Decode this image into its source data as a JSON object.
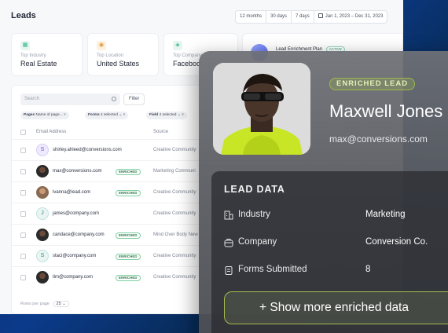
{
  "leads_page": {
    "title": "Leads",
    "range_tabs": [
      "12 months",
      "30 days",
      "7 days"
    ],
    "date_range": "Jan 1, 2023 – Dec 31, 2023",
    "stats": [
      {
        "label": "Top Industry",
        "value": "Real Estate",
        "icon": "building-icon",
        "color": "#2fb38a"
      },
      {
        "label": "Top Location",
        "value": "United States",
        "icon": "location-icon",
        "color": "#e1962b"
      },
      {
        "label": "Top Company",
        "value": "Faceboo",
        "icon": "company-icon",
        "color": "#2fb38a"
      }
    ],
    "plan": {
      "title": "Lead Enrichment Plan",
      "badge": "ACTIVE"
    },
    "table": {
      "search_placeholder": "Search",
      "filter_label": "Filter",
      "chips": [
        {
          "key": "Pages",
          "value": "Name of page..."
        },
        {
          "key": "Forms",
          "value": "4 selected"
        },
        {
          "key": "Field",
          "value": "4 selected"
        }
      ],
      "columns": [
        "Email Address",
        "Source"
      ],
      "rows": [
        {
          "avatar": "S",
          "avatar_type": "letter-purple",
          "email": "shirley.ahleed@conversions.com",
          "enriched": false,
          "source": "Creative Community"
        },
        {
          "avatar": "",
          "avatar_type": "photo",
          "email": "max@conversions.com",
          "enriched": true,
          "source": "Marketing Communi"
        },
        {
          "avatar": "",
          "avatar_type": "photo",
          "email": "lvanna@lead.com",
          "enriched": true,
          "source": "Creative Community"
        },
        {
          "avatar": "J",
          "avatar_type": "letter",
          "email": "james@company.com",
          "enriched": false,
          "source": "Creative Community"
        },
        {
          "avatar": "",
          "avatar_type": "photo",
          "email": "candace@company.com",
          "enriched": true,
          "source": "Mind Over Body New"
        },
        {
          "avatar": "S",
          "avatar_type": "letter",
          "email": "staci@company.com",
          "enriched": true,
          "source": "Creative Community"
        },
        {
          "avatar": "",
          "avatar_type": "photo",
          "email": "tim@company.com",
          "enriched": true,
          "source": "Creative Community"
        }
      ],
      "enriched_label": "ENRICHED",
      "rows_per_page_label": "Rows per page",
      "rows_per_page_value": "25"
    }
  },
  "lead_card": {
    "badge": "ENRICHED LEAD",
    "name": "Maxwell Jones",
    "email": "max@conversions.com",
    "data_title": "LEAD DATA",
    "fields": [
      {
        "icon": "building-icon",
        "label": "Industry",
        "value": "Marketing"
      },
      {
        "icon": "company-icon",
        "label": "Company",
        "value": "Conversion Co."
      },
      {
        "icon": "form-icon",
        "label": "Forms Submitted",
        "value": "8"
      }
    ],
    "more_button": "+ Show more enriched data",
    "accent": "#a3bd4c"
  }
}
